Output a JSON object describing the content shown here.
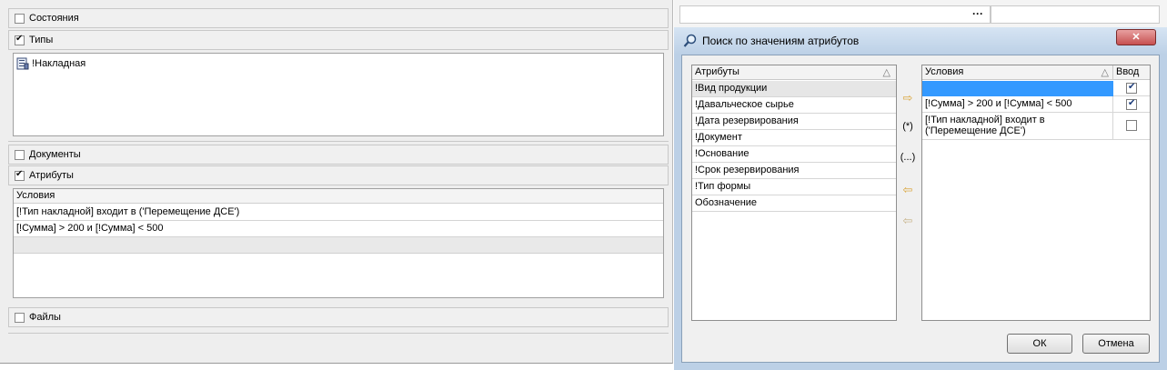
{
  "left_panel": {
    "sections": {
      "states": {
        "label": "Состояния",
        "checked": false
      },
      "types": {
        "label": "Типы",
        "checked": true
      },
      "documents": {
        "label": "Документы",
        "checked": false
      },
      "attributes": {
        "label": "Атрибуты",
        "checked": true
      },
      "files": {
        "label": "Файлы",
        "checked": false
      }
    },
    "types_list": {
      "items": [
        "!Накладная"
      ]
    },
    "conditions_grid": {
      "header": "Условия",
      "rows": [
        "[!Тип накладной] входит в ('Перемещение ДСЕ')",
        "[!Сумма] > 200 и [!Сумма] < 500"
      ]
    }
  },
  "top_field": {
    "ellipsis": "···"
  },
  "dialog": {
    "title": "Поиск по значениям атрибутов",
    "close_glyph": "✕",
    "attributes_list": {
      "header": "Атрибуты",
      "sort_glyph": "△",
      "items": [
        "!Вид продукции",
        "!Давальческое сырье",
        "!Дата резервирования",
        "!Документ",
        "!Основание",
        "!Срок резервирования",
        "!Тип формы",
        "Обозначение"
      ]
    },
    "middle_buttons": {
      "add": "⇨",
      "star": "(*)",
      "ellipsis": "(...)",
      "remove": "⇦",
      "remove_all": "⇦"
    },
    "conditions_list": {
      "header": "Условия",
      "sort_glyph": "△",
      "input_header": "Ввод",
      "rows": [
        {
          "text": "",
          "input": true
        },
        {
          "text": "[!Сумма] > 200 и [!Сумма] < 500",
          "input": true
        },
        {
          "text": "[!Тип накладной] входит в ('Перемещение ДСЕ')",
          "input": false
        }
      ]
    },
    "ok_label": "ОК",
    "cancel_label": "Отмена"
  },
  "colors": {
    "selection": "#3399ff",
    "dialog_frame": "#bcd0e6",
    "close_button": "#c75050"
  }
}
